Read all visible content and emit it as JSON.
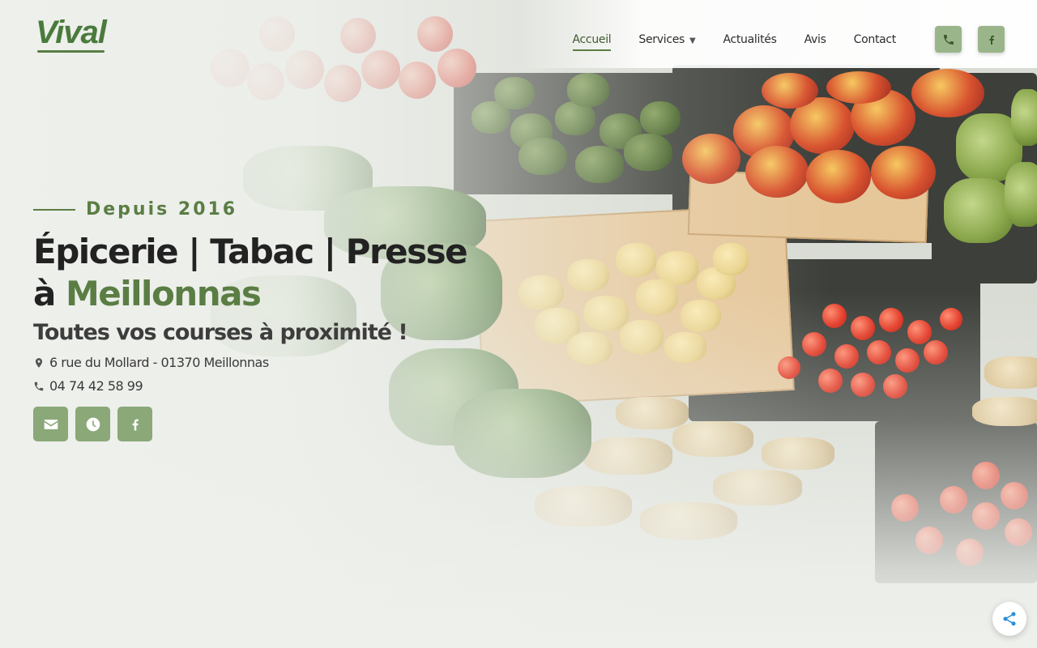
{
  "brand": {
    "logo_text": "Vival"
  },
  "nav": {
    "items": [
      {
        "label": "Accueil",
        "active": true
      },
      {
        "label": "Services",
        "has_dropdown": true
      },
      {
        "label": "Actualités"
      },
      {
        "label": "Avis"
      },
      {
        "label": "Contact"
      }
    ],
    "icons": [
      "phone-icon",
      "facebook-icon"
    ]
  },
  "hero": {
    "tagline": "Depuis 2016",
    "headline_line1": "Épicerie | Tabac | Presse",
    "headline_prefix": "à ",
    "headline_accent": "Meillonnas",
    "subheadline": "Toutes vos courses à proximité !",
    "address": "6 rue du Mollard - 01370 Meillonnas",
    "phone": "04 74 42 58 99",
    "social_icons": [
      "envelope-icon",
      "clock-icon",
      "facebook-icon"
    ]
  },
  "floating": {
    "share_icon": "share-icon"
  },
  "colors": {
    "accent": "#5a7d44",
    "button_green": "#8aa878",
    "nav_button_green": "#9bb58a",
    "share_blue": "#2a8fd6"
  }
}
